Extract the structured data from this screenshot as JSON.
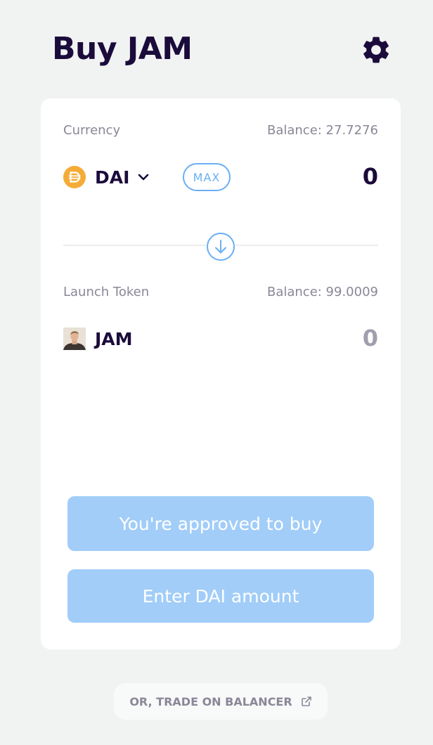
{
  "header": {
    "title": "Buy JAM",
    "settings_icon": "gear-icon"
  },
  "colors": {
    "title": "#1b0b3b",
    "accent": "#6aaef5",
    "button_disabled_bg": "#a1cdf8",
    "muted_text": "#8a8797",
    "dai_gold": "#f5ac37"
  },
  "currency": {
    "label": "Currency",
    "balance": "Balance: 27.7276",
    "token": "DAI",
    "token_icon": "dai-icon",
    "max_label": "MAX",
    "amount": "0"
  },
  "launch_token": {
    "label": "Launch Token",
    "balance": "Balance: 99.0009",
    "token": "JAM",
    "token_icon": "avatar",
    "amount": "0"
  },
  "buttons": {
    "approved_label": "You're approved to buy",
    "enter_amount_label": "Enter DAI amount"
  },
  "footer": {
    "trade_link_label": "OR, TRADE ON BALANCER",
    "trade_link_icon": "external-link-icon"
  }
}
